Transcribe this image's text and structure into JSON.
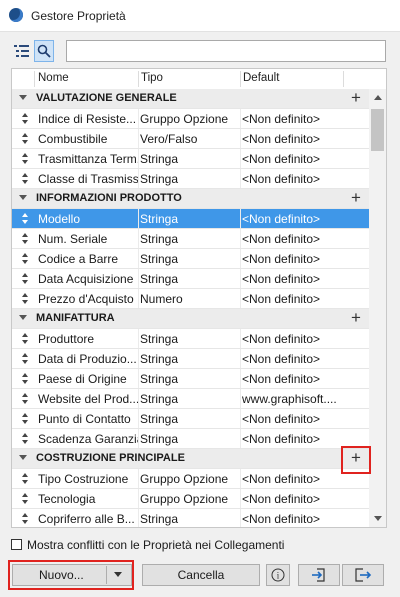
{
  "window": {
    "title": "Gestore Proprietà"
  },
  "toolbar": {
    "search_value": ""
  },
  "table": {
    "columns": [
      "Nome",
      "Tipo",
      "Default"
    ],
    "sections": [
      {
        "title": "VALUTAZIONE GENERALE",
        "rows": [
          {
            "name": "Indice di Resiste...",
            "type": "Gruppo Opzione",
            "default": "<Non definito>"
          },
          {
            "name": "Combustibile",
            "type": "Vero/Falso",
            "default": "<Non definito>"
          },
          {
            "name": "Trasmittanza Term...",
            "type": "Stringa",
            "default": "<Non definito>"
          },
          {
            "name": "Classe di Trasmiss...",
            "type": "Stringa",
            "default": "<Non definito>"
          }
        ]
      },
      {
        "title": "INFORMAZIONI PRODOTTO",
        "rows": [
          {
            "name": "Modello",
            "type": "Stringa",
            "default": "<Non definito>",
            "selected": true
          },
          {
            "name": "Num. Seriale",
            "type": "Stringa",
            "default": "<Non definito>"
          },
          {
            "name": "Codice a Barre",
            "type": "Stringa",
            "default": "<Non definito>"
          },
          {
            "name": "Data Acquisizione",
            "type": "Stringa",
            "default": "<Non definito>"
          },
          {
            "name": "Prezzo d'Acquisto",
            "type": "Numero",
            "default": "<Non definito>"
          }
        ]
      },
      {
        "title": "MANIFATTURA",
        "rows": [
          {
            "name": "Produttore",
            "type": "Stringa",
            "default": "<Non definito>"
          },
          {
            "name": "Data di Produzio...",
            "type": "Stringa",
            "default": "<Non definito>"
          },
          {
            "name": "Paese di Origine",
            "type": "Stringa",
            "default": "<Non definito>"
          },
          {
            "name": "Website del Prod...",
            "type": "Stringa",
            "default": "www.graphisoft...."
          },
          {
            "name": "Punto di Contatto",
            "type": "Stringa",
            "default": "<Non definito>"
          },
          {
            "name": "Scadenza Garanzia",
            "type": "Stringa",
            "default": "<Non definito>"
          }
        ]
      },
      {
        "title": "COSTRUZIONE PRINCIPALE",
        "highlight": true,
        "rows": [
          {
            "name": "Tipo Costruzione",
            "type": "Gruppo Opzione",
            "default": "<Non definito>"
          },
          {
            "name": "Tecnologia",
            "type": "Gruppo Opzione",
            "default": "<Non definito>"
          },
          {
            "name": "Copriferro alle B...",
            "type": "Stringa",
            "default": "<Non definito>"
          }
        ]
      }
    ],
    "add_symbol": "+"
  },
  "footer": {
    "checkbox_label": "Mostra conflitti con le Proprietà nei Collegamenti",
    "new_label": "Nuovo...",
    "delete_label": "Cancella",
    "info_symbol": "i"
  },
  "colors": {
    "selection": "#3f97e8",
    "highlight": "#e0231f",
    "section_bg": "#ececec"
  }
}
